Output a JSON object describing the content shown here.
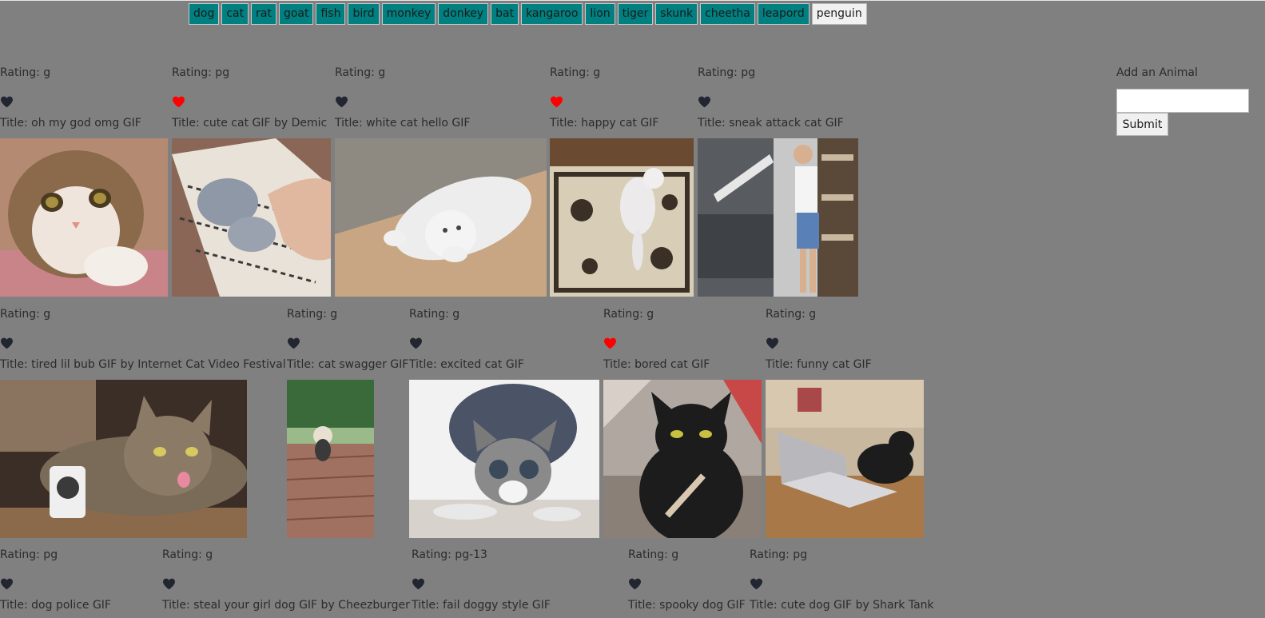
{
  "animal_buttons": [
    "dog",
    "cat",
    "rat",
    "goat",
    "fish",
    "bird",
    "monkey",
    "donkey",
    "bat",
    "kangaroo",
    "lion",
    "tiger",
    "skunk",
    "cheetha",
    "leapord",
    "penguin"
  ],
  "add_animal": {
    "label": "Add an Animal",
    "input_value": "",
    "submit_label": "Submit"
  },
  "heart_colors": {
    "liked": "#ff0000",
    "unliked": "#222630"
  },
  "gifs": [
    {
      "rating": "Rating: g",
      "liked": false,
      "title": "Title: oh my god omg GIF"
    },
    {
      "rating": "Rating: pg",
      "liked": true,
      "title": "Title: cute cat GIF by Demic"
    },
    {
      "rating": "Rating: g",
      "liked": false,
      "title": "Title: white cat hello GIF"
    },
    {
      "rating": "Rating: g",
      "liked": true,
      "title": "Title: happy cat GIF"
    },
    {
      "rating": "Rating: pg",
      "liked": false,
      "title": "Title: sneak attack cat GIF"
    },
    {
      "rating": "Rating: g",
      "liked": false,
      "title": "Title: tired lil bub GIF by Internet Cat Video Festival"
    },
    {
      "rating": "Rating: g",
      "liked": false,
      "title": "Title: cat swagger GIF"
    },
    {
      "rating": "Rating: g",
      "liked": false,
      "title": "Title: excited cat GIF"
    },
    {
      "rating": "Rating: g",
      "liked": true,
      "title": "Title: bored cat GIF"
    },
    {
      "rating": "Rating: g",
      "liked": false,
      "title": "Title: funny cat GIF"
    },
    {
      "rating": "Rating: pg",
      "liked": false,
      "title": "Title: dog police GIF"
    },
    {
      "rating": "Rating: g",
      "liked": false,
      "title": "Title: steal your girl dog GIF by Cheezburger"
    },
    {
      "rating": "Rating: pg-13",
      "liked": false,
      "title": "Title: fail doggy style GIF"
    },
    {
      "rating": "Rating: g",
      "liked": false,
      "title": "Title: spooky dog GIF"
    },
    {
      "rating": "Rating: pg",
      "liked": false,
      "title": "Title: cute dog GIF by Shark Tank"
    }
  ]
}
